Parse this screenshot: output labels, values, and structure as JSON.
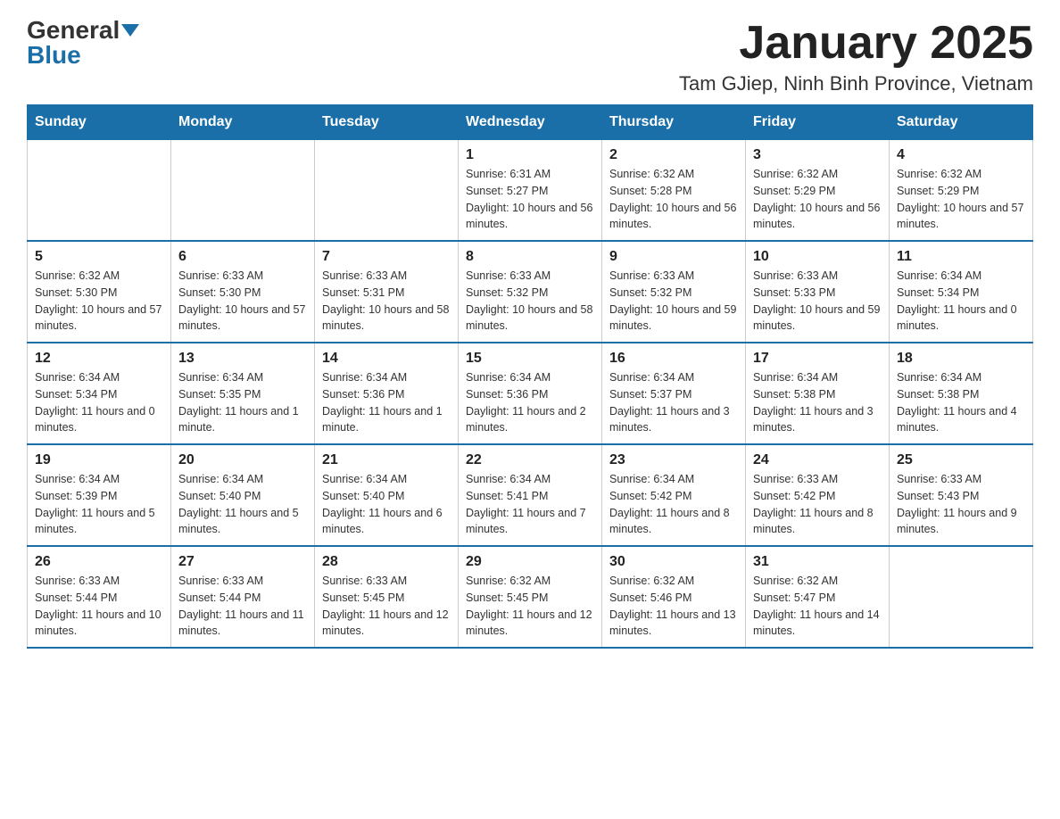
{
  "logo": {
    "general": "General",
    "blue": "Blue"
  },
  "title": {
    "month_year": "January 2025",
    "location": "Tam GJiep, Ninh Binh Province, Vietnam"
  },
  "days_of_week": [
    "Sunday",
    "Monday",
    "Tuesday",
    "Wednesday",
    "Thursday",
    "Friday",
    "Saturday"
  ],
  "weeks": [
    [
      {
        "day": "",
        "info": ""
      },
      {
        "day": "",
        "info": ""
      },
      {
        "day": "",
        "info": ""
      },
      {
        "day": "1",
        "info": "Sunrise: 6:31 AM\nSunset: 5:27 PM\nDaylight: 10 hours and 56 minutes."
      },
      {
        "day": "2",
        "info": "Sunrise: 6:32 AM\nSunset: 5:28 PM\nDaylight: 10 hours and 56 minutes."
      },
      {
        "day": "3",
        "info": "Sunrise: 6:32 AM\nSunset: 5:29 PM\nDaylight: 10 hours and 56 minutes."
      },
      {
        "day": "4",
        "info": "Sunrise: 6:32 AM\nSunset: 5:29 PM\nDaylight: 10 hours and 57 minutes."
      }
    ],
    [
      {
        "day": "5",
        "info": "Sunrise: 6:32 AM\nSunset: 5:30 PM\nDaylight: 10 hours and 57 minutes."
      },
      {
        "day": "6",
        "info": "Sunrise: 6:33 AM\nSunset: 5:30 PM\nDaylight: 10 hours and 57 minutes."
      },
      {
        "day": "7",
        "info": "Sunrise: 6:33 AM\nSunset: 5:31 PM\nDaylight: 10 hours and 58 minutes."
      },
      {
        "day": "8",
        "info": "Sunrise: 6:33 AM\nSunset: 5:32 PM\nDaylight: 10 hours and 58 minutes."
      },
      {
        "day": "9",
        "info": "Sunrise: 6:33 AM\nSunset: 5:32 PM\nDaylight: 10 hours and 59 minutes."
      },
      {
        "day": "10",
        "info": "Sunrise: 6:33 AM\nSunset: 5:33 PM\nDaylight: 10 hours and 59 minutes."
      },
      {
        "day": "11",
        "info": "Sunrise: 6:34 AM\nSunset: 5:34 PM\nDaylight: 11 hours and 0 minutes."
      }
    ],
    [
      {
        "day": "12",
        "info": "Sunrise: 6:34 AM\nSunset: 5:34 PM\nDaylight: 11 hours and 0 minutes."
      },
      {
        "day": "13",
        "info": "Sunrise: 6:34 AM\nSunset: 5:35 PM\nDaylight: 11 hours and 1 minute."
      },
      {
        "day": "14",
        "info": "Sunrise: 6:34 AM\nSunset: 5:36 PM\nDaylight: 11 hours and 1 minute."
      },
      {
        "day": "15",
        "info": "Sunrise: 6:34 AM\nSunset: 5:36 PM\nDaylight: 11 hours and 2 minutes."
      },
      {
        "day": "16",
        "info": "Sunrise: 6:34 AM\nSunset: 5:37 PM\nDaylight: 11 hours and 3 minutes."
      },
      {
        "day": "17",
        "info": "Sunrise: 6:34 AM\nSunset: 5:38 PM\nDaylight: 11 hours and 3 minutes."
      },
      {
        "day": "18",
        "info": "Sunrise: 6:34 AM\nSunset: 5:38 PM\nDaylight: 11 hours and 4 minutes."
      }
    ],
    [
      {
        "day": "19",
        "info": "Sunrise: 6:34 AM\nSunset: 5:39 PM\nDaylight: 11 hours and 5 minutes."
      },
      {
        "day": "20",
        "info": "Sunrise: 6:34 AM\nSunset: 5:40 PM\nDaylight: 11 hours and 5 minutes."
      },
      {
        "day": "21",
        "info": "Sunrise: 6:34 AM\nSunset: 5:40 PM\nDaylight: 11 hours and 6 minutes."
      },
      {
        "day": "22",
        "info": "Sunrise: 6:34 AM\nSunset: 5:41 PM\nDaylight: 11 hours and 7 minutes."
      },
      {
        "day": "23",
        "info": "Sunrise: 6:34 AM\nSunset: 5:42 PM\nDaylight: 11 hours and 8 minutes."
      },
      {
        "day": "24",
        "info": "Sunrise: 6:33 AM\nSunset: 5:42 PM\nDaylight: 11 hours and 8 minutes."
      },
      {
        "day": "25",
        "info": "Sunrise: 6:33 AM\nSunset: 5:43 PM\nDaylight: 11 hours and 9 minutes."
      }
    ],
    [
      {
        "day": "26",
        "info": "Sunrise: 6:33 AM\nSunset: 5:44 PM\nDaylight: 11 hours and 10 minutes."
      },
      {
        "day": "27",
        "info": "Sunrise: 6:33 AM\nSunset: 5:44 PM\nDaylight: 11 hours and 11 minutes."
      },
      {
        "day": "28",
        "info": "Sunrise: 6:33 AM\nSunset: 5:45 PM\nDaylight: 11 hours and 12 minutes."
      },
      {
        "day": "29",
        "info": "Sunrise: 6:32 AM\nSunset: 5:45 PM\nDaylight: 11 hours and 12 minutes."
      },
      {
        "day": "30",
        "info": "Sunrise: 6:32 AM\nSunset: 5:46 PM\nDaylight: 11 hours and 13 minutes."
      },
      {
        "day": "31",
        "info": "Sunrise: 6:32 AM\nSunset: 5:47 PM\nDaylight: 11 hours and 14 minutes."
      },
      {
        "day": "",
        "info": ""
      }
    ]
  ]
}
